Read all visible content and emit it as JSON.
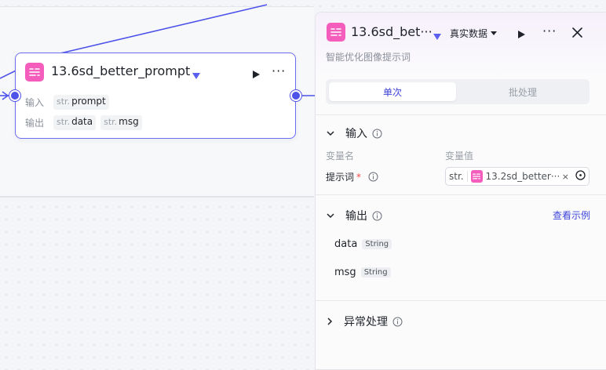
{
  "colors": {
    "accent": "#4d53e8",
    "node_icon": "#f45dbb",
    "link": "#3e44d9"
  },
  "node": {
    "title": "13.6sd_better_prompt",
    "input_label": "输入",
    "output_label": "输出",
    "inputs": [
      {
        "prefix": "str.",
        "name": "prompt"
      }
    ],
    "outputs": [
      {
        "prefix": "str.",
        "name": "data"
      },
      {
        "prefix": "str.",
        "name": "msg"
      }
    ]
  },
  "panel": {
    "title": "13.6sd_bet···",
    "mode_label": "真实数据",
    "description": "智能优化图像提示词",
    "tabs": {
      "single": "单次",
      "batch": "批处理"
    },
    "input_section": {
      "title": "输入",
      "col_name": "变量名",
      "col_value": "变量值",
      "param_label": "提示词",
      "required_mark": "*",
      "ref_prefix": "str.",
      "ref_text": "13.2sd_better···  ·",
      "clear": "×"
    },
    "output_section": {
      "title": "输出",
      "view_example": "查看示例",
      "items": [
        {
          "name": "data",
          "type": "String"
        },
        {
          "name": "msg",
          "type": "String"
        }
      ]
    },
    "exception_section": {
      "title": "异常处理"
    }
  }
}
